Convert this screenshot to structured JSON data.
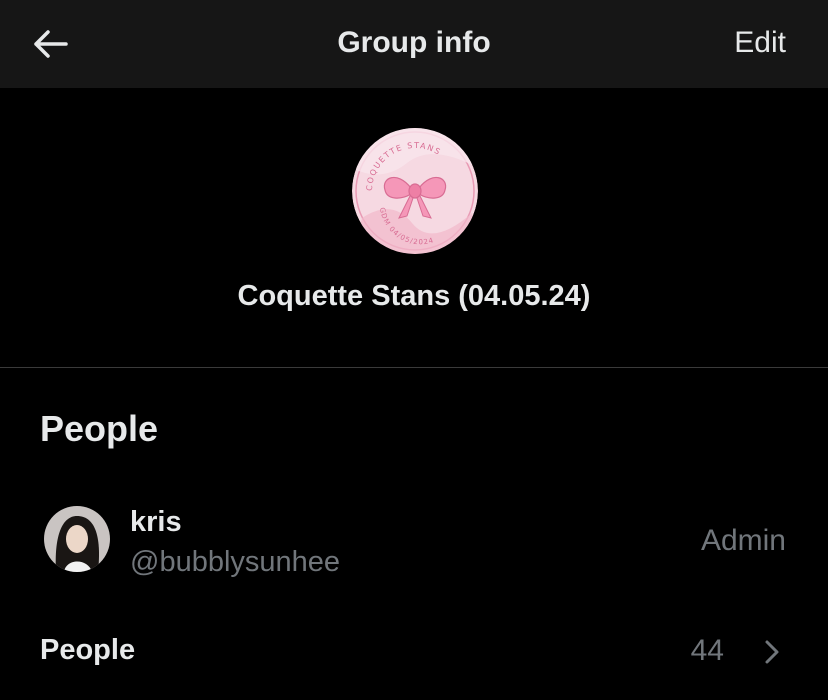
{
  "header": {
    "title": "Group info",
    "edit_label": "Edit"
  },
  "group": {
    "name": "Coquette Stans (04.05.24)",
    "badge_text_top": "COQUETTE STANS",
    "badge_text_bottom": "GDM 04/05/2024"
  },
  "people_section": {
    "title": "People",
    "members": [
      {
        "name": "kris",
        "handle": "@bubblysunhee",
        "role": "Admin"
      }
    ],
    "people_row_label": "People",
    "people_count": "44"
  },
  "colors": {
    "background": "#000000",
    "header_bg": "#161616",
    "primary_text": "#e7e9ea",
    "secondary_text": "#71767b",
    "divider": "#3a3a3a",
    "badge_pink": "#f4c6d4"
  },
  "icons": {
    "back": "arrow-left-icon",
    "chevron": "chevron-right-icon"
  }
}
